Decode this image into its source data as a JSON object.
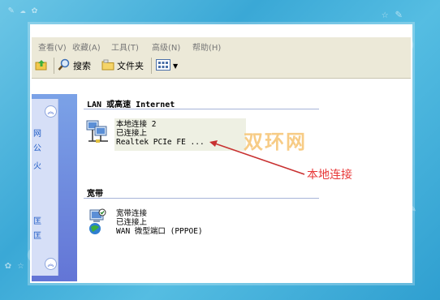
{
  "menubar": {
    "items": [
      {
        "label": "查看(V)"
      },
      {
        "label": "收藏(A)"
      },
      {
        "label": "工具(T)"
      },
      {
        "label": "高级(N)"
      },
      {
        "label": "帮助(H)"
      }
    ]
  },
  "toolbar": {
    "search_label": "搜索",
    "folders_label": "文件夹",
    "views_icon": "views-grid-icon"
  },
  "sidepanel": {
    "text": [
      "网",
      "公",
      "火",
      "匡",
      "匡"
    ]
  },
  "groups": {
    "lan_header": "LAN 或高速 Internet",
    "broadband_header": "宽带"
  },
  "connections": {
    "local": {
      "name": "本地连接 2",
      "status": "已连接上",
      "device": "Realtek PCIe FE ..."
    },
    "broadband": {
      "name": "宽带连接",
      "status": "已连接上",
      "device": "WAN 微型端口 (PPPOE)"
    }
  },
  "annotation": {
    "label": "本地连接",
    "color": "#e83838"
  },
  "watermark": "双环网"
}
